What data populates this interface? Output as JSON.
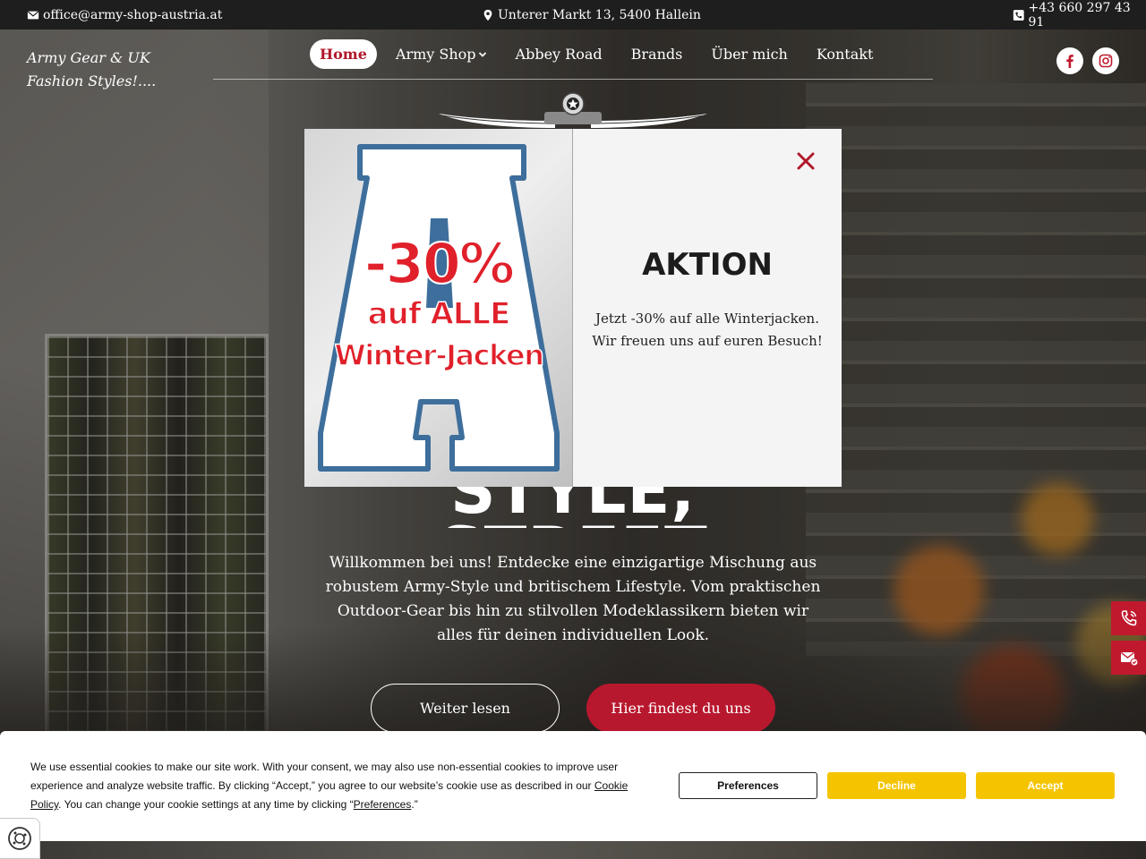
{
  "topbar": {
    "email": "office@army-shop-austria.at",
    "address": "Unterer Markt 13, 5400 Hallein",
    "phone": "+43 660 297 43 91"
  },
  "header": {
    "tagline": "Army Gear & UK Fashion Styles!....",
    "nav": [
      {
        "label": "Home",
        "active": true
      },
      {
        "label": "Army Shop",
        "dropdown": true
      },
      {
        "label": "Abbey Road"
      },
      {
        "label": "Brands"
      },
      {
        "label": "Über mich"
      },
      {
        "label": "Kontakt"
      }
    ],
    "social": [
      "facebook-icon",
      "instagram-icon"
    ]
  },
  "hero": {
    "title_partial": "STYLE, STREET",
    "text": "Willkommen bei uns! Entdecke eine einzigartige Mischung aus robustem Army-Style und britischem Lifestyle. Vom praktischen Outdoor-Gear bis hin zu stilvollen Modeklassikern bieten wir alles für deinen individuellen Look.",
    "btn_read_more": "Weiter lesen",
    "btn_find_us": "Hier findest du uns"
  },
  "popup": {
    "image_text": {
      "percent": "-30%",
      "line1": "auf ALLE",
      "line2": "Winter-Jacken"
    },
    "title": "AKTION",
    "text_line1": "Jetzt -30% auf alle Winterjacken.",
    "text_line2": "Wir freuen uns auf euren Besuch!"
  },
  "cookie": {
    "text_part1": "We use essential cookies to make our site work. With your consent, we may also use non-essential cookies to improve user experience and analyze website traffic. By clicking “Accept,” you agree to our website’s cookie use as described in our ",
    "link_policy": "Cookie Policy",
    "text_part2": ". You can change your cookie settings at any time by clicking “",
    "link_preferences": "Preferences",
    "text_part3": ".”",
    "btn_preferences": "Preferences",
    "btn_decline": "Decline",
    "btn_accept": "Accept"
  },
  "colors": {
    "brand_red": "#b8182e",
    "cookie_yellow": "#f5c400",
    "topbar_bg": "#1e1e1e"
  }
}
